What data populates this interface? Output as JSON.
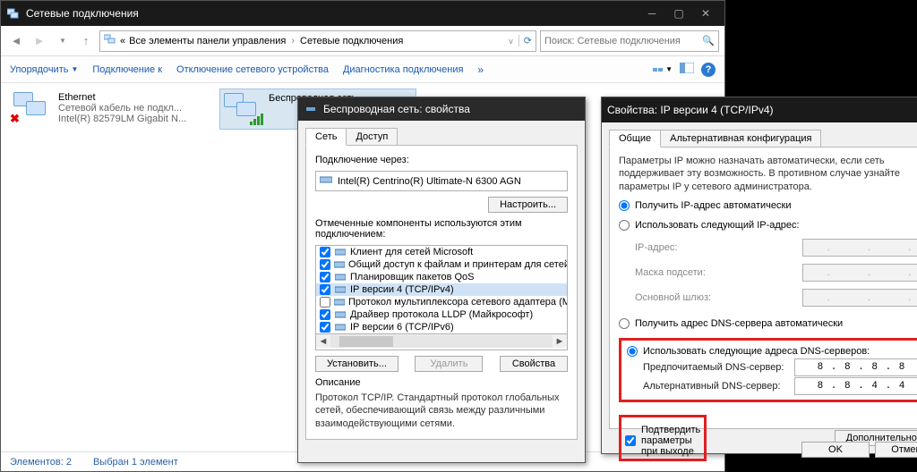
{
  "nc": {
    "title": "Сетевые подключения",
    "breadcrumb_prefix": "«",
    "breadcrumb_1": "Все элементы панели управления",
    "breadcrumb_2": "Сетевые подключения",
    "search_placeholder": "Поиск: Сетевые подключения",
    "toolbar": {
      "organize": "Упорядочить",
      "connect": "Подключение к",
      "disable": "Отключение сетевого устройства",
      "diagnose": "Диагностика подключения"
    },
    "items": [
      {
        "name": "Ethernet",
        "line2": "Сетевой кабель не подкл...",
        "line3": "Intel(R) 82579LM Gigabit N..."
      },
      {
        "name": "Беспроводная сеть",
        "line2": "",
        "line3": ""
      }
    ],
    "status_left": "Элементов: 2",
    "status_sel": "Выбран 1 элемент"
  },
  "pw": {
    "title": "Беспроводная сеть: свойства",
    "tab_net": "Сеть",
    "tab_access": "Доступ",
    "conn_via_label": "Подключение через:",
    "adapter": "Intel(R) Centrino(R) Ultimate-N 6300 AGN",
    "configure_btn": "Настроить...",
    "components_label": "Отмеченные компоненты используются этим подключением:",
    "components": [
      {
        "label": "Клиент для сетей Microsoft",
        "checked": true
      },
      {
        "label": "Общий доступ к файлам и принтерам для сетей Mi",
        "checked": true
      },
      {
        "label": "Планировщик пакетов QoS",
        "checked": true
      },
      {
        "label": "IP версии 4 (TCP/IPv4)",
        "checked": true,
        "selected": true
      },
      {
        "label": "Протокол мультиплексора сетевого адаптера (Ма",
        "checked": false
      },
      {
        "label": "Драйвер протокола LLDP (Майкрософт)",
        "checked": true
      },
      {
        "label": "IP версии 6 (TCP/IPv6)",
        "checked": true
      }
    ],
    "install_btn": "Установить...",
    "remove_btn": "Удалить",
    "props_btn": "Свойства",
    "desc_label": "Описание",
    "desc_text": "Протокол TCP/IP. Стандартный протокол глобальных сетей, обеспечивающий связь между различными взаимодействующими сетями."
  },
  "ipv4": {
    "title": "Свойства: IP версии 4 (TCP/IPv4)",
    "tab_general": "Общие",
    "tab_alt": "Альтернативная конфигурация",
    "hint": "Параметры IP можно назначать автоматически, если сеть поддерживает эту возможность. В противном случае узнайте параметры IP у сетевого администратора.",
    "radio_auto_ip": "Получить IP-адрес автоматически",
    "radio_manual_ip": "Использовать следующий IP-адрес:",
    "ip_label": "IP-адрес:",
    "mask_label": "Маска подсети:",
    "gw_label": "Основной шлюз:",
    "radio_auto_dns": "Получить адрес DNS-сервера автоматически",
    "radio_manual_dns": "Использовать следующие адреса DNS-серверов:",
    "dns_pref_label": "Предпочитаемый DNS-сервер:",
    "dns_alt_label": "Альтернативный DNS-сервер:",
    "dns_pref_value": "8 . 8 . 8 . 8",
    "dns_alt_value": "8 . 8 . 4 . 4",
    "confirm_exit": "Подтвердить параметры при выходе",
    "advanced_btn": "Дополнительно...",
    "ok_btn": "OK",
    "cancel_btn": "Отмена"
  }
}
